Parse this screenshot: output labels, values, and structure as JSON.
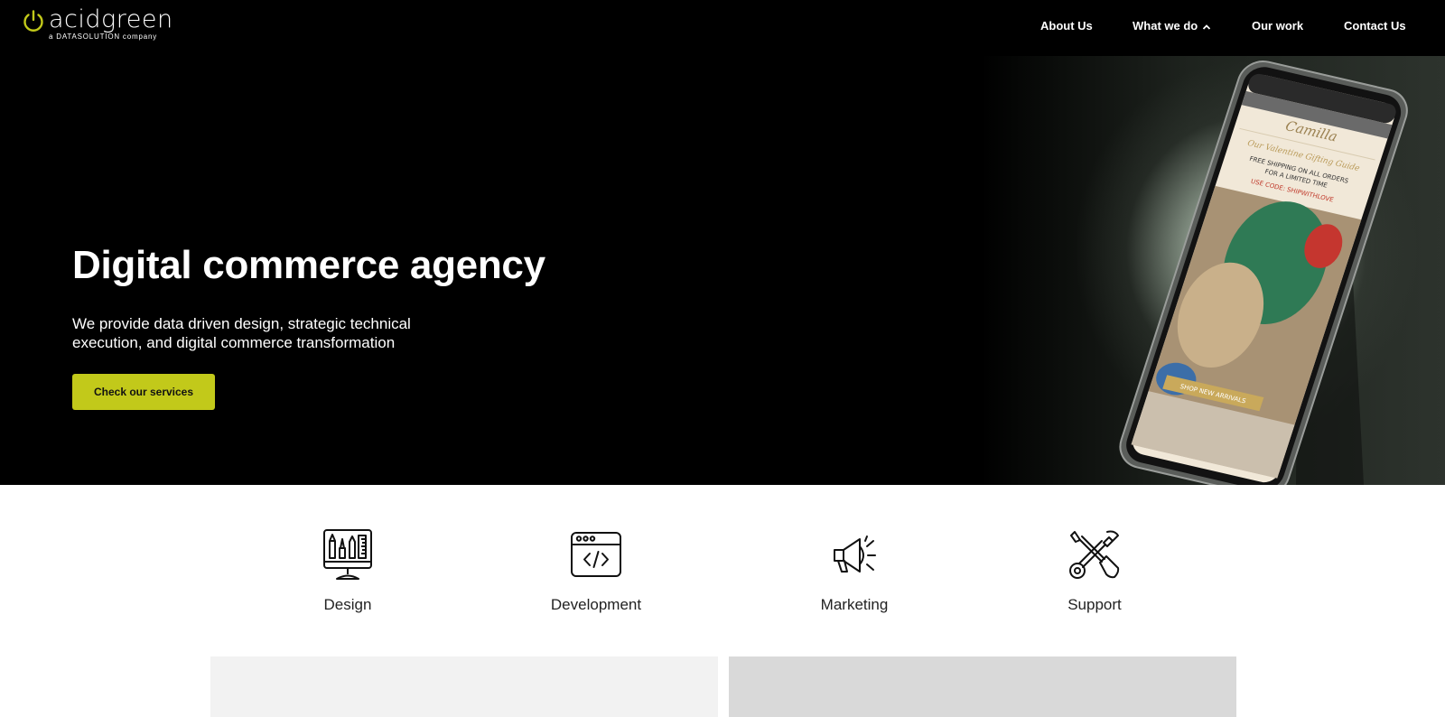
{
  "header": {
    "logo": {
      "name": "acidgreen",
      "tagline": "a DATASOLUTION company",
      "icon": "power-icon",
      "accent": "#c2c91a"
    },
    "nav": [
      {
        "label": "About Us"
      },
      {
        "label": "What we do",
        "icon": "chevron-up-icon"
      },
      {
        "label": "Our work"
      },
      {
        "label": "Contact Us"
      }
    ]
  },
  "hero": {
    "title": "Digital commerce agency",
    "subtitle": "We provide data driven design, strategic technical execution, and digital commerce transformation",
    "cta_label": "Check our services",
    "cta_color": "#c2c91a",
    "phone_screen": {
      "brand": "Camilla",
      "promo_script": "Our Valentine Gifting Guide",
      "shipping_line1": "FREE SHIPPING ON ALL ORDERS",
      "shipping_line2": "FOR A LIMITED TIME",
      "code_text": "USE CODE: SHIPWITHLOVE",
      "banner_button": "SHOP NEW ARRIVALS"
    }
  },
  "services": [
    {
      "label": "Design",
      "icon": "design-tools-monitor-icon"
    },
    {
      "label": "Development",
      "icon": "code-window-icon"
    },
    {
      "label": "Marketing",
      "icon": "megaphone-icon"
    },
    {
      "label": "Support",
      "icon": "wrench-screwdriver-icon"
    }
  ],
  "cards": [
    {
      "color": "#f2f2f2"
    },
    {
      "color": "#d9d9d9"
    }
  ]
}
